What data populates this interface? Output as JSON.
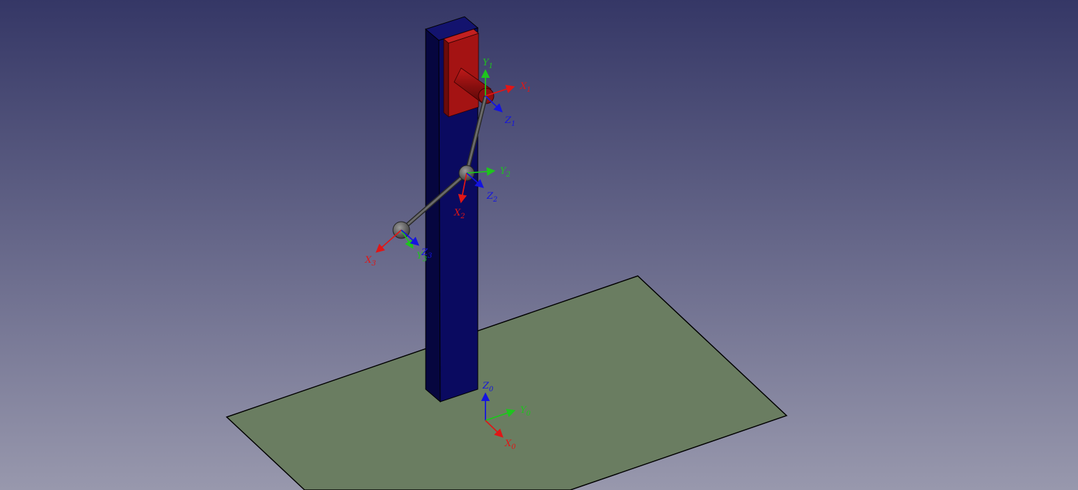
{
  "viewport": {
    "background_top": "#353766",
    "background_bottom": "#9898ad"
  },
  "scene": {
    "ground_color": "#6a7d61",
    "column_front_color": "#0a0a60",
    "column_side_color": "#06063f",
    "column_top_color": "#13136e",
    "plate_color": "#a41313",
    "plate_dark_color": "#6a0b0b",
    "link_color": "#555555",
    "joint_color": "#6c6c6c"
  },
  "axis_colors": {
    "x": "#e01616",
    "y": "#1ec41e",
    "z": "#1414e0"
  },
  "frames": {
    "frame0": {
      "x": {
        "letter": "X",
        "sub": "0"
      },
      "y": {
        "letter": "Y",
        "sub": "0"
      },
      "z": {
        "letter": "Z",
        "sub": "0"
      }
    },
    "frame1": {
      "x": {
        "letter": "X",
        "sub": "1"
      },
      "y": {
        "letter": "Y",
        "sub": "1"
      },
      "z": {
        "letter": "Z",
        "sub": "1"
      }
    },
    "frame2": {
      "x": {
        "letter": "X",
        "sub": "2"
      },
      "y": {
        "letter": "Y",
        "sub": "2"
      },
      "z": {
        "letter": "Z",
        "sub": "2"
      }
    },
    "frame3": {
      "x": {
        "letter": "X",
        "sub": "3"
      },
      "y": {
        "letter": "Y",
        "sub": "3"
      },
      "z": {
        "letter": "Z",
        "sub": "3"
      }
    }
  }
}
